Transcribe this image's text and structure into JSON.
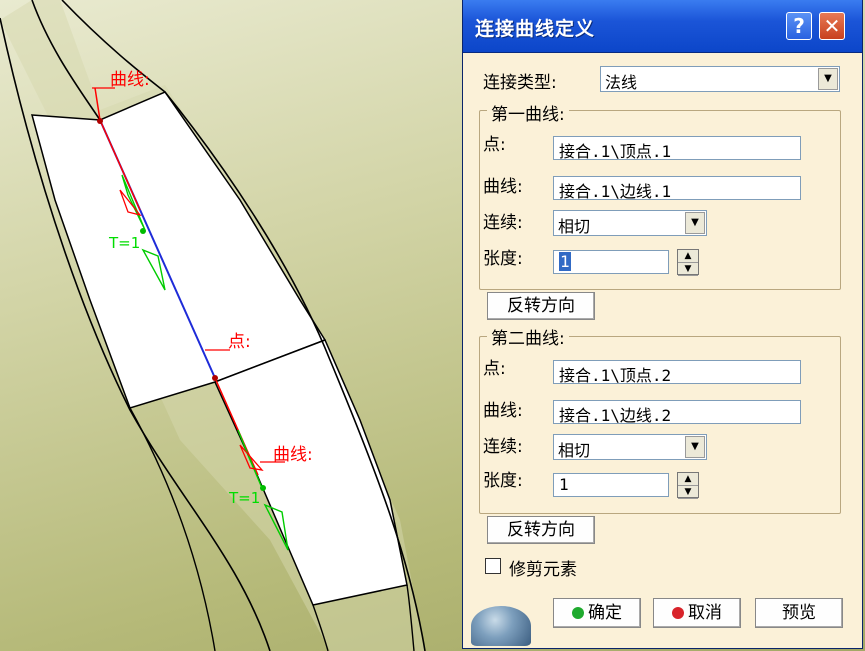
{
  "viewport": {
    "labels": {
      "curve_label_1": "曲线:",
      "point_label": "点:",
      "curve_label_2": "曲线:",
      "tension_label_1": "T=1",
      "tension_label_2": "T=1"
    }
  },
  "dialog": {
    "title": "连接曲线定义",
    "help_symbol": "?",
    "close_symbol": "✕",
    "connection_type_label": "连接类型:",
    "connection_type_value": "法线",
    "first_curve": {
      "legend": "第一曲线:",
      "point_label": "点:",
      "point_value": "接合.1\\顶点.1",
      "curve_label": "曲线:",
      "curve_value": "接合.1\\边线.1",
      "continuity_label": "连续:",
      "continuity_value": "相切",
      "tension_label": "张度:",
      "tension_value": "1",
      "reverse_button": "反转方向"
    },
    "second_curve": {
      "legend": "第二曲线:",
      "point_label": "点:",
      "point_value": "接合.1\\顶点.2",
      "curve_label": "曲线:",
      "curve_value": "接合.1\\边线.2",
      "continuity_label": "连续:",
      "continuity_value": "相切",
      "tension_label": "张度:",
      "tension_value": "1",
      "reverse_button": "反转方向"
    },
    "trim_elements_label": "修剪元素",
    "trim_elements_checked": false,
    "ok_button": "确定",
    "cancel_button": "取消",
    "preview_button": "预览",
    "colors": {
      "ok_dot": "#1faa2e",
      "cancel_dot": "#d8232a",
      "titlebar": "#1b55d8"
    }
  }
}
